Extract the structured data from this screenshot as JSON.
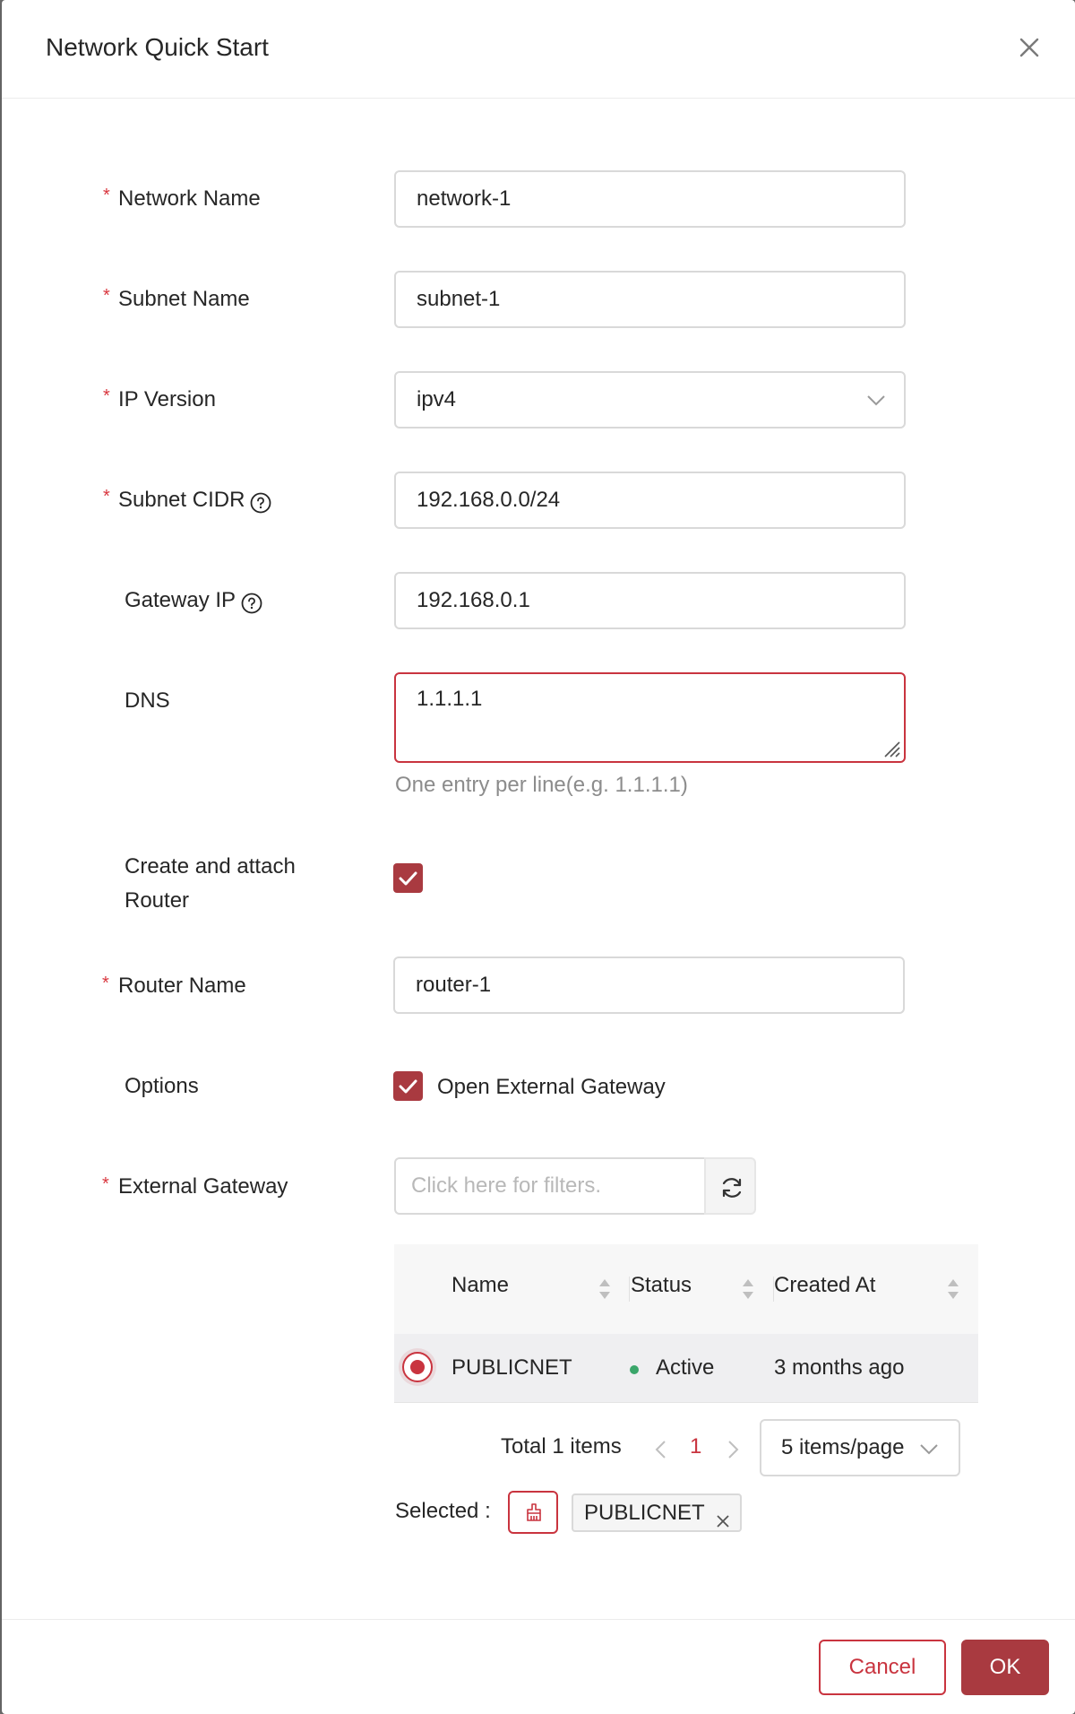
{
  "modal": {
    "title": "Network Quick Start"
  },
  "form": {
    "network_name": {
      "label": "Network Name",
      "value": "network-1",
      "required": true
    },
    "subnet_name": {
      "label": "Subnet Name",
      "value": "subnet-1",
      "required": true
    },
    "ip_version": {
      "label": "IP Version",
      "value": "ipv4",
      "required": true
    },
    "subnet_cidr": {
      "label": "Subnet CIDR",
      "value": "192.168.0.0/24",
      "required": true
    },
    "gateway_ip": {
      "label": "Gateway IP",
      "value": "192.168.0.1",
      "required": false
    },
    "dns": {
      "label": "DNS",
      "value": "1.1.1.1",
      "hint": "One entry per line(e.g. 1.1.1.1)"
    },
    "create_router": {
      "label_line1": "Create and attach",
      "label_line2": "Router",
      "checked": true
    },
    "router_name": {
      "label": "Router Name",
      "value": "router-1",
      "required": true
    },
    "options": {
      "label": "Options",
      "checkbox_label": "Open External Gateway",
      "checked": true
    },
    "external_gateway": {
      "label": "External Gateway",
      "filter_placeholder": "Click here for filters.",
      "required": true
    }
  },
  "table": {
    "columns": [
      "Name",
      "Status",
      "Created At"
    ],
    "rows": [
      {
        "name": "PUBLICNET",
        "status": "Active",
        "created_at": "3 months ago",
        "selected": true
      }
    ]
  },
  "pagination": {
    "total": "Total 1 items",
    "current_page": "1",
    "page_size": "5 items/page"
  },
  "selection": {
    "label": "Selected :",
    "tags": [
      "PUBLICNET"
    ]
  },
  "footer": {
    "cancel": "Cancel",
    "ok": "OK"
  },
  "colors": {
    "primary": "#a93a40",
    "danger": "#c9343f",
    "status_active": "#3aa66a"
  }
}
